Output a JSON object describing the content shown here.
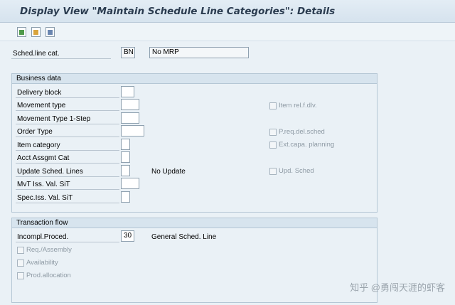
{
  "window": {
    "title": "Display View \"Maintain Schedule Line Categories\": Details"
  },
  "toolbar": {
    "icons": [
      "new-entries-icon",
      "copy-as-icon",
      "delete-icon"
    ]
  },
  "header": {
    "sched_line_cat_label": "Sched.line cat.",
    "sched_line_cat_value": "BN",
    "sched_line_cat_desc": "No MRP"
  },
  "business_data": {
    "title": "Business data",
    "delivery_block_label": "Delivery block",
    "movement_type_label": "Movement type",
    "movement_type_1step_label": "Movement Type 1-Step",
    "order_type_label": "Order Type",
    "item_category_label": "Item category",
    "acct_assgmt_cat_label": "Acct Assgmt Cat",
    "update_sched_lines_label": "Update Sched. Lines",
    "update_sched_lines_text": "No Update",
    "mvt_iss_val_sit_label": "MvT Iss. Val. SiT",
    "spec_iss_val_sit_label": "Spec.Iss. Val. SiT",
    "item_rel_dlv_label": "Item rel.f.dlv.",
    "p_req_del_sched_label": "P.req.del.sched",
    "ext_capa_planning_label": "Ext.capa. planning",
    "upd_sched_label": "Upd. Sched"
  },
  "transaction_flow": {
    "title": "Transaction flow",
    "incompl_proced_label": "Incompl.Proced.",
    "incompl_proced_value": "30",
    "incompl_proced_desc": "General Sched. Line",
    "req_assembly_label": "Req./Assembly",
    "availability_label": "Availability",
    "prod_allocation_label": "Prod.allocation"
  },
  "watermark": {
    "text": "知乎 @勇闯天涯的虾客"
  }
}
